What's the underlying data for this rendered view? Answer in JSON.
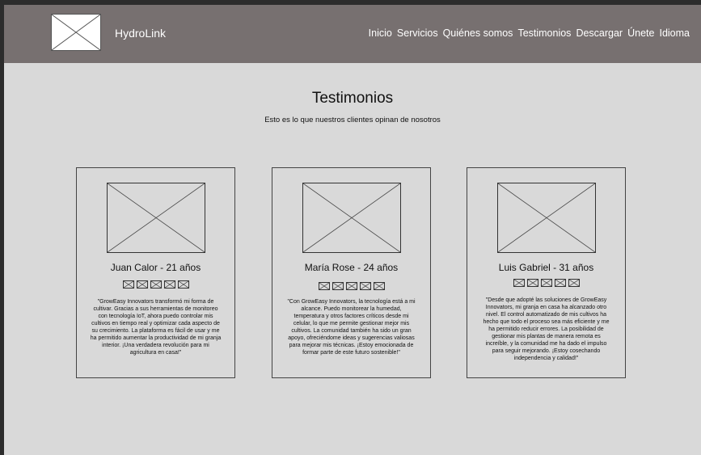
{
  "header": {
    "brand": "HydroLink",
    "nav": [
      "Inicio",
      "Servicios",
      "Quiénes somos",
      "Testimonios",
      "Descargar",
      "Únete",
      "Idioma"
    ]
  },
  "main": {
    "title": "Testimonios",
    "subtitle": "Esto es lo que nuestros clientes opinan de nosotros"
  },
  "testimonials": [
    {
      "name": "Juan Calor - 21 años",
      "stars": 5,
      "quote": "\"GrowEasy Innovators transformó mi forma de cultivar. Gracias a sus herramientas de monitoreo con tecnología IoT, ahora puedo controlar mis cultivos en tiempo real y optimizar cada aspecto de su crecimiento. La plataforma es fácil de usar y me ha permitido aumentar la productividad de mi granja interior. ¡Una verdadera revolución para mi agricultura en casa!\""
    },
    {
      "name": "María Rose - 24 años",
      "stars": 5,
      "quote": "\"Con GrowEasy Innovators, la tecnología está a mi alcance. Puedo monitorear la humedad, temperatura y otros factores críticos desde mi celular, lo que me permite gestionar mejor mis cultivos. La comunidad también ha sido un gran apoyo, ofreciéndome ideas y sugerencias valiosas para mejorar mis técnicas. ¡Estoy emocionada de formar parte de este futuro sostenible!\""
    },
    {
      "name": "Luis Gabriel - 31 años",
      "stars": 5,
      "quote": "\"Desde que adopté las soluciones de GrowEasy Innovators, mi granja en casa ha alcanzado otro nivel. El control automatizado de mis cultivos ha hecho que todo el proceso sea más eficiente y me ha permitido reducir errores. La posibilidad de gestionar mis plantas de manera remota es increíble, y la comunidad me ha dado el impulso para seguir mejorando. ¡Estoy cosechando independencia y calidad!\""
    }
  ]
}
